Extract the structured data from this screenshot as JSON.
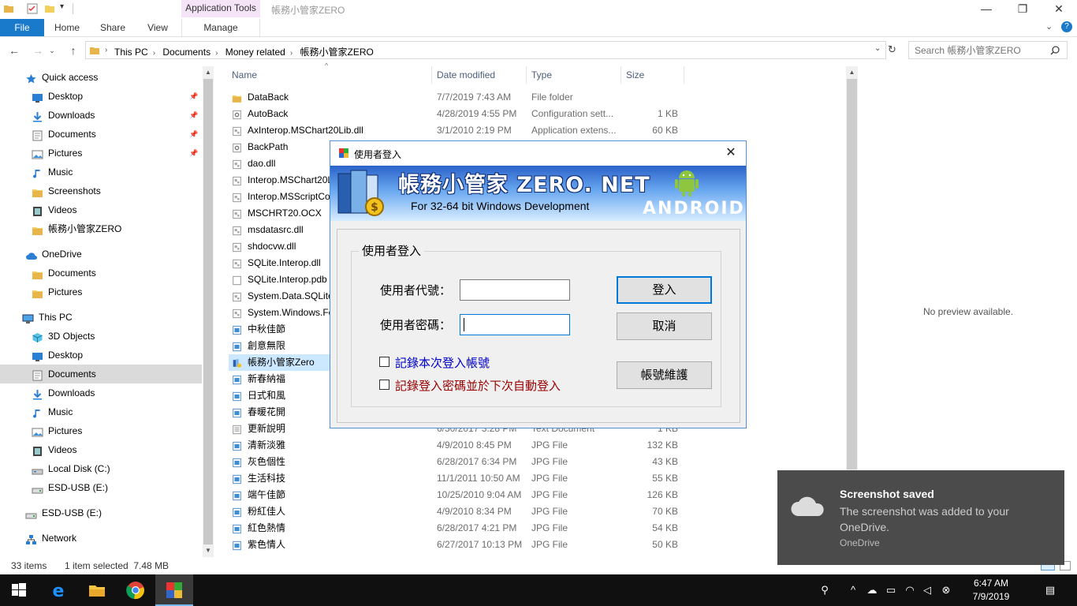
{
  "window": {
    "contextual_tab_group": "Application Tools",
    "title": "帳務小管家ZERO"
  },
  "ribbon": {
    "tabs": [
      "File",
      "Home",
      "Share",
      "View",
      "Manage"
    ]
  },
  "address": {
    "crumbs": [
      "This PC",
      "Documents",
      "Money related",
      "帳務小管家ZERO"
    ],
    "search_placeholder": "Search 帳務小管家ZERO"
  },
  "nav": {
    "items": [
      {
        "label": "Quick access",
        "icon": "star-icon"
      },
      {
        "label": "Desktop",
        "icon": "desktop-icon",
        "pinned": true
      },
      {
        "label": "Downloads",
        "icon": "download-icon",
        "pinned": true
      },
      {
        "label": "Documents",
        "icon": "document-icon",
        "pinned": true
      },
      {
        "label": "Pictures",
        "icon": "pictures-icon",
        "pinned": true
      },
      {
        "label": "Music",
        "icon": "music-icon"
      },
      {
        "label": "Screenshots",
        "icon": "folder-icon"
      },
      {
        "label": "Videos",
        "icon": "video-icon"
      },
      {
        "label": "帳務小管家ZERO",
        "icon": "folder-icon"
      },
      {
        "label": "OneDrive",
        "icon": "cloud-icon"
      },
      {
        "label": "Documents",
        "icon": "folder-icon"
      },
      {
        "label": "Pictures",
        "icon": "folder-icon"
      },
      {
        "label": "This PC",
        "icon": "computer-icon"
      },
      {
        "label": "3D Objects",
        "icon": "cube-icon"
      },
      {
        "label": "Desktop",
        "icon": "desktop-icon"
      },
      {
        "label": "Documents",
        "icon": "document-icon"
      },
      {
        "label": "Downloads",
        "icon": "download-icon"
      },
      {
        "label": "Music",
        "icon": "music-icon"
      },
      {
        "label": "Pictures",
        "icon": "pictures-icon"
      },
      {
        "label": "Videos",
        "icon": "video-icon"
      },
      {
        "label": "Local Disk (C:)",
        "icon": "drive-icon"
      },
      {
        "label": "ESD-USB (E:)",
        "icon": "usb-drive-icon"
      },
      {
        "label": "ESD-USB (E:)",
        "icon": "usb-drive-icon"
      },
      {
        "label": "Network",
        "icon": "network-icon"
      }
    ]
  },
  "columns": {
    "name": "Name",
    "date": "Date modified",
    "type": "Type",
    "size": "Size"
  },
  "files": [
    {
      "name": "DataBack",
      "date": "7/7/2019 7:43 AM",
      "type": "File folder",
      "size": "",
      "icon": "folder-icon"
    },
    {
      "name": "AutoBack",
      "date": "4/28/2019 4:55 PM",
      "type": "Configuration sett...",
      "size": "1 KB",
      "icon": "config-file-icon"
    },
    {
      "name": "AxInterop.MSChart20Lib.dll",
      "date": "3/1/2010 2:19 PM",
      "type": "Application extens...",
      "size": "60 KB",
      "icon": "dll-file-icon"
    },
    {
      "name": "BackPath",
      "date": "",
      "type": "",
      "size": "",
      "icon": "config-file-icon"
    },
    {
      "name": "dao.dll",
      "date": "",
      "type": "",
      "size": "",
      "icon": "dll-file-icon"
    },
    {
      "name": "Interop.MSChart20L",
      "date": "",
      "type": "",
      "size": "",
      "icon": "dll-file-icon"
    },
    {
      "name": "Interop.MSScriptCo",
      "date": "",
      "type": "",
      "size": "",
      "icon": "dll-file-icon"
    },
    {
      "name": "MSCHRT20.OCX",
      "date": "",
      "type": "",
      "size": "",
      "icon": "dll-file-icon"
    },
    {
      "name": "msdatasrc.dll",
      "date": "",
      "type": "",
      "size": "",
      "icon": "dll-file-icon"
    },
    {
      "name": "shdocvw.dll",
      "date": "",
      "type": "",
      "size": "",
      "icon": "dll-file-icon"
    },
    {
      "name": "SQLite.Interop.dll",
      "date": "",
      "type": "",
      "size": "",
      "icon": "dll-file-icon"
    },
    {
      "name": "SQLite.Interop.pdb",
      "date": "",
      "type": "",
      "size": "",
      "icon": "file-icon"
    },
    {
      "name": "System.Data.SQLite.",
      "date": "",
      "type": "",
      "size": "",
      "icon": "dll-file-icon"
    },
    {
      "name": "System.Windows.Fo",
      "date": "",
      "type": "",
      "size": "",
      "icon": "dll-file-icon"
    },
    {
      "name": "中秋佳節",
      "date": "",
      "type": "",
      "size": "",
      "icon": "image-file-icon"
    },
    {
      "name": "創意無限",
      "date": "",
      "type": "",
      "size": "",
      "icon": "image-file-icon"
    },
    {
      "name": "帳務小管家Zero",
      "date": "",
      "type": "",
      "size": "",
      "icon": "app-icon",
      "selected": true
    },
    {
      "name": "新春納福",
      "date": "",
      "type": "",
      "size": "",
      "icon": "image-file-icon"
    },
    {
      "name": "日式和風",
      "date": "",
      "type": "",
      "size": "",
      "icon": "image-file-icon"
    },
    {
      "name": "春暖花開",
      "date": "",
      "type": "",
      "size": "",
      "icon": "image-file-icon"
    },
    {
      "name": "更新說明",
      "date": "6/30/2017 3:28 PM",
      "type": "Text Document",
      "size": "1 KB",
      "icon": "text-file-icon"
    },
    {
      "name": "清新淡雅",
      "date": "4/9/2010 8:45 PM",
      "type": "JPG File",
      "size": "132 KB",
      "icon": "image-file-icon"
    },
    {
      "name": "灰色個性",
      "date": "6/28/2017 6:34 PM",
      "type": "JPG File",
      "size": "43 KB",
      "icon": "image-file-icon"
    },
    {
      "name": "生活科技",
      "date": "11/1/2011 10:50 AM",
      "type": "JPG File",
      "size": "55 KB",
      "icon": "image-file-icon"
    },
    {
      "name": "端午佳節",
      "date": "10/25/2010 9:04 AM",
      "type": "JPG File",
      "size": "126 KB",
      "icon": "image-file-icon"
    },
    {
      "name": "粉紅佳人",
      "date": "4/9/2010 8:34 PM",
      "type": "JPG File",
      "size": "70 KB",
      "icon": "image-file-icon"
    },
    {
      "name": "紅色熱情",
      "date": "6/28/2017 4:21 PM",
      "type": "JPG File",
      "size": "54 KB",
      "icon": "image-file-icon"
    },
    {
      "name": "紫色情人",
      "date": "6/27/2017 10:13 PM",
      "type": "JPG File",
      "size": "50 KB",
      "icon": "image-file-icon"
    }
  ],
  "preview": {
    "text": "No preview available."
  },
  "status": {
    "count": "33 items",
    "selection": "1 item selected  7.48 MB"
  },
  "dialog": {
    "title": "使用者登入",
    "banner_title": "帳務小管家 ZERO. NET",
    "banner_subtitle": "For 32-64 bit Windows Development",
    "banner_android": "ANDROID",
    "group_label": "使用者登入",
    "user_label": "使用者代號：",
    "password_label": "使用者密碼：",
    "user_value": "",
    "password_value": "",
    "login_button": "登入",
    "cancel_button": "取消",
    "account_button": "帳號維護",
    "remember_account": "記錄本次登入帳號",
    "remember_password": "記錄登入密碼並於下次自動登入",
    "remember_account_color": "#0000cc",
    "remember_password_color": "#990000"
  },
  "toast": {
    "title": "Screenshot saved",
    "body": "The screenshot was added to your OneDrive.",
    "source": "OneDrive"
  },
  "taskbar": {
    "time": "6:47 AM",
    "date": "7/9/2019"
  },
  "colors": {
    "accent": "#1979ca",
    "selection": "#cce8ff",
    "toast_bg": "#4b4b4b"
  }
}
